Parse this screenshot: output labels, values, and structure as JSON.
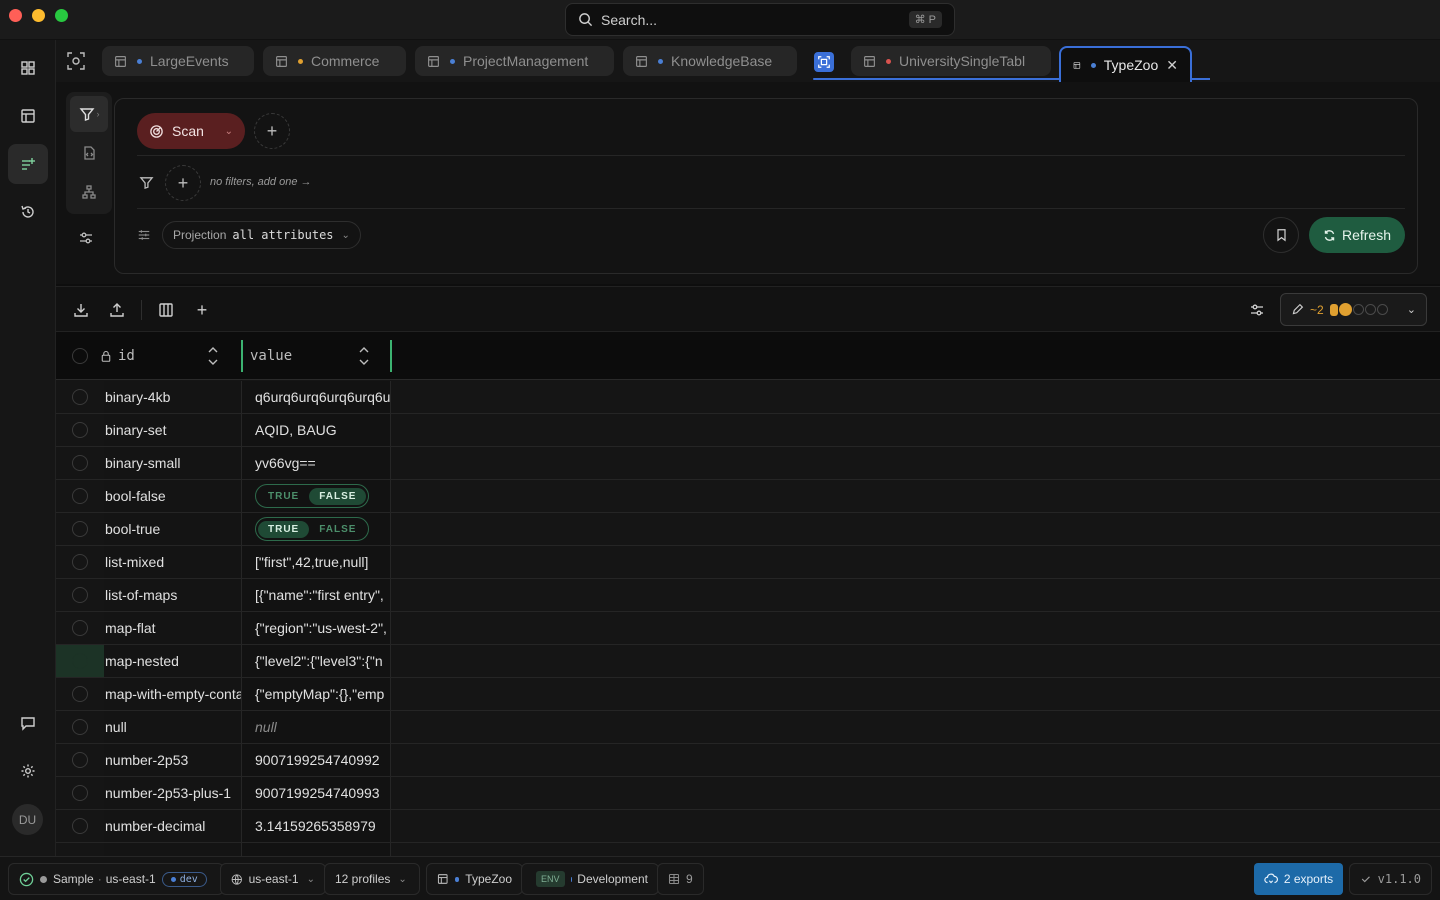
{
  "window": {
    "search_placeholder": "Search...",
    "search_shortcut": "⌘ P"
  },
  "tabs": [
    {
      "label": "LargeEvents",
      "dot_color": "#4a7fd4"
    },
    {
      "label": "Commerce",
      "dot_color": "#e0a030"
    },
    {
      "label": "ProjectManagement",
      "dot_color": "#4a7fd4"
    },
    {
      "label": "KnowledgeBase",
      "dot_color": "#4a7fd4"
    },
    {
      "label": "UniversitySingleTabl",
      "dot_color": "#d9534f"
    },
    {
      "label": "TypeZoo",
      "dot_color": "#4a7fd4",
      "active": true
    }
  ],
  "query": {
    "operation": "Scan",
    "filters_hint": "no filters, add one →",
    "projection_label": "Projection",
    "projection_value": "all attributes",
    "refresh_label": "Refresh"
  },
  "density": {
    "zoom": "~2"
  },
  "table": {
    "columns": [
      {
        "label": "id"
      },
      {
        "label": "value"
      }
    ],
    "rows": [
      {
        "id": "binary-4kb",
        "value": "q6urq6urq6urq6urq6u"
      },
      {
        "id": "binary-set",
        "value": "AQID, BAUG"
      },
      {
        "id": "binary-small",
        "value": "yv66vg=="
      },
      {
        "id": "bool-false",
        "value": "",
        "bool": false
      },
      {
        "id": "bool-true",
        "value": "",
        "bool": true
      },
      {
        "id": "list-mixed",
        "value": "[\"first\",42,true,null]"
      },
      {
        "id": "list-of-maps",
        "value": "[{\"name\":\"first entry\","
      },
      {
        "id": "map-flat",
        "value": "{\"region\":\"us-west-2\","
      },
      {
        "id": "map-nested",
        "value": "{\"level2\":{\"level3\":{\"n",
        "selected": true
      },
      {
        "id": "map-with-empty-conta",
        "value": "{\"emptyMap\":{},\"emp"
      },
      {
        "id": "null",
        "value": "null",
        "is_null": true
      },
      {
        "id": "number-2p53",
        "value": "9007199254740992"
      },
      {
        "id": "number-2p53-plus-1",
        "value": "9007199254740993"
      },
      {
        "id": "number-decimal",
        "value": "3.14159265358979"
      }
    ],
    "bool_true_label": "TRUE",
    "bool_false_label": "FALSE"
  },
  "statusbar": {
    "connection": "Sample",
    "region": "us-east-1",
    "env_pill": "dev",
    "region_select": "us-east-1",
    "profiles": "12 profiles",
    "table_name": "TypeZoo",
    "env_badge": "ENV",
    "environment": "Development",
    "table_count": "9",
    "exports": "2 exports",
    "version": "v1.1.0"
  },
  "user": {
    "initials": "DU"
  }
}
